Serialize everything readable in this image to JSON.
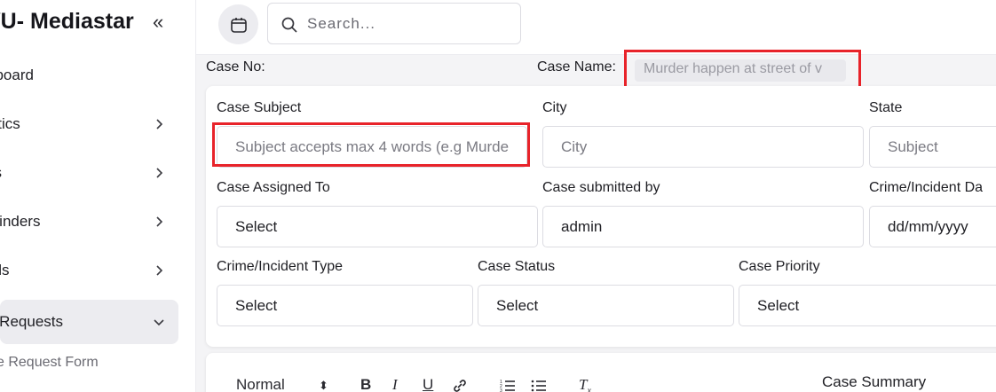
{
  "sidebar": {
    "brand": "VU- Mediastar",
    "collapse_icon": "double-chevron-left-icon",
    "items": [
      {
        "label": "hboard"
      },
      {
        "label": "lytics"
      },
      {
        "label": "ks"
      },
      {
        "label": "minders"
      },
      {
        "label": "ails"
      },
      {
        "label": "e Requests"
      }
    ],
    "sub_item": "se Request Form"
  },
  "topbar": {
    "calendar_icon": "calendar-icon",
    "search_placeholder": "Search..."
  },
  "case_header": {
    "case_no_label": "Case No:",
    "case_name_label": "Case Name:",
    "case_name_value": "Murder happen at street of v"
  },
  "form": {
    "case_subject": {
      "label": "Case Subject",
      "placeholder": "Subject accepts max 4 words (e.g Murde"
    },
    "city": {
      "label": "City",
      "placeholder": "City"
    },
    "state": {
      "label": "State",
      "placeholder": "Subject"
    },
    "case_assigned_to": {
      "label": "Case Assigned To",
      "value": "Select"
    },
    "case_submitted_by": {
      "label": "Case submitted by",
      "value": "admin"
    },
    "crime_incident_date": {
      "label": "Crime/Incident Da",
      "value": "dd/mm/yyyy"
    },
    "crime_incident_type": {
      "label": "Crime/Incident Type",
      "value": "Select"
    },
    "case_status": {
      "label": "Case Status",
      "value": "Select"
    },
    "case_priority": {
      "label": "Case Priority",
      "value": "Select"
    }
  },
  "editor": {
    "format_select": "Normal",
    "summary_label": "Case Summary"
  },
  "colors": {
    "highlight": "#e8232a",
    "background": "#f4f4f6",
    "active_nav": "#ececf0"
  }
}
